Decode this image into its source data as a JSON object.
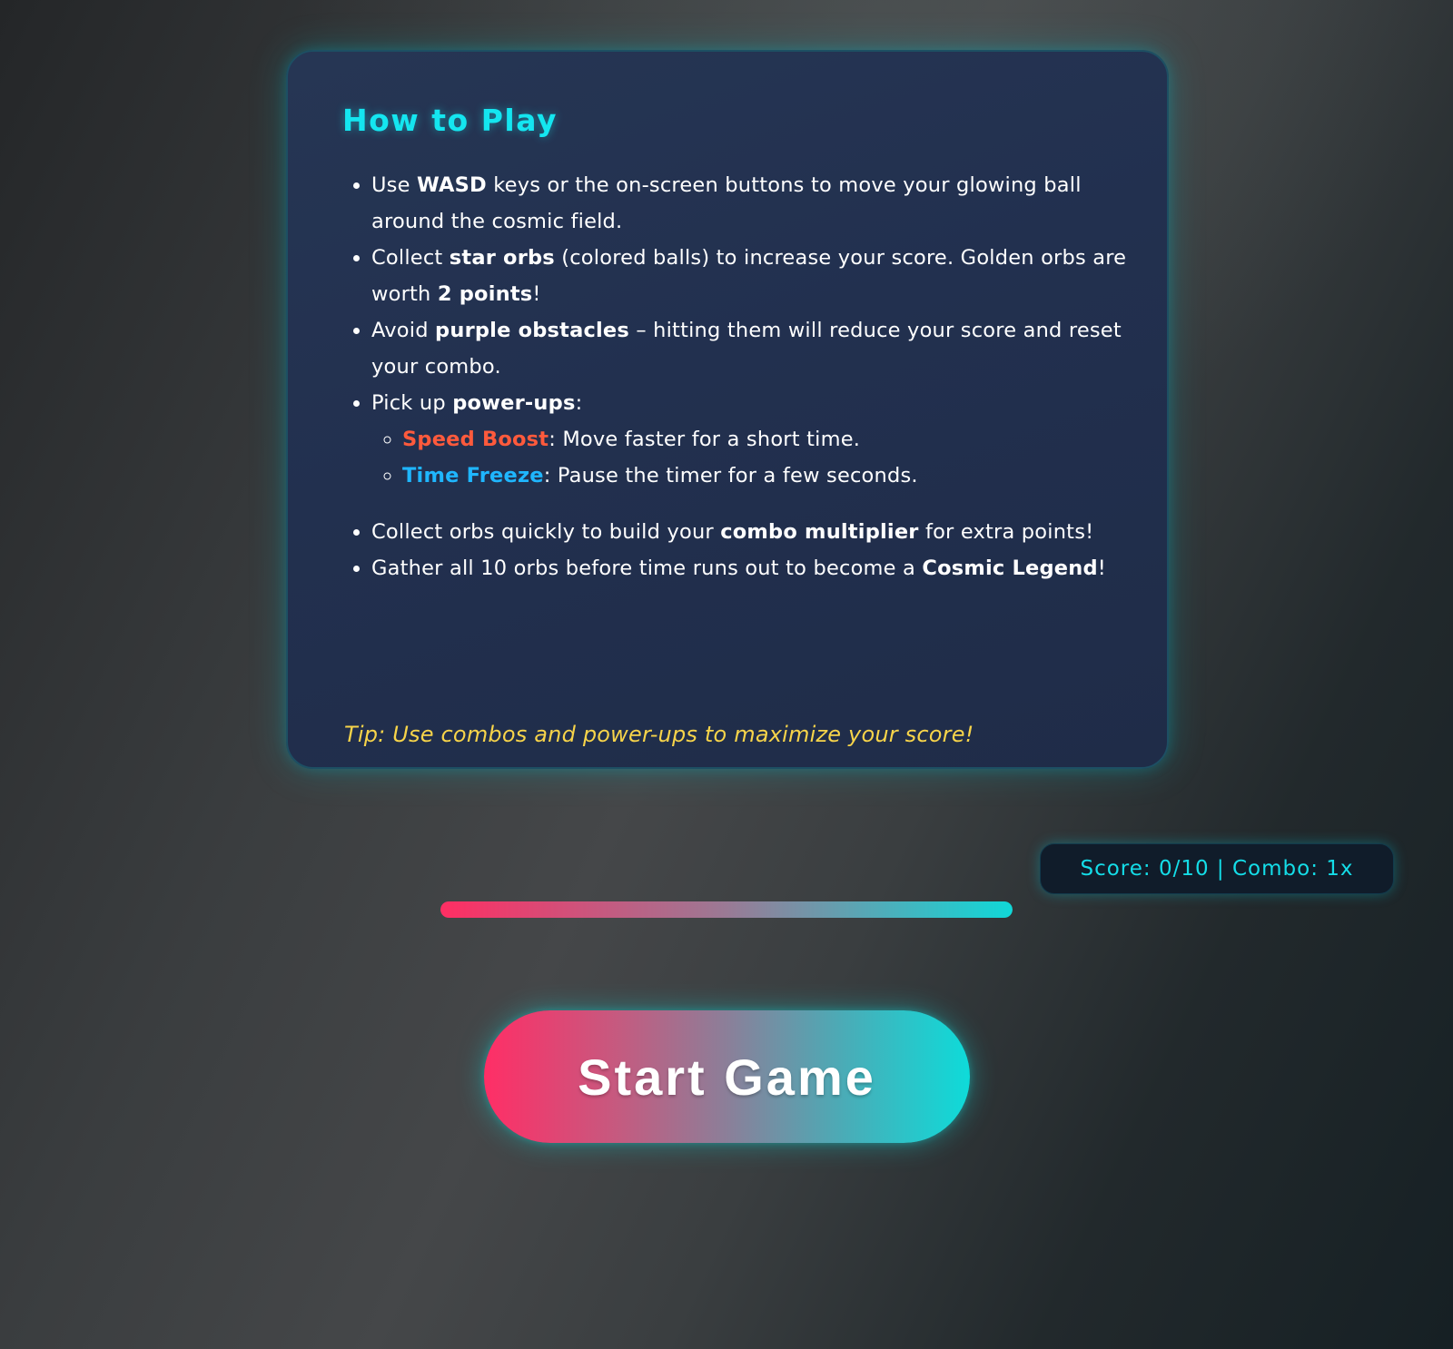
{
  "instructions": {
    "title": "How to Play",
    "rules": [
      {
        "parts": [
          {
            "text": "Use ",
            "strong": false
          },
          {
            "text": "WASD",
            "strong": true
          },
          {
            "text": " keys or the on-screen buttons to move your glowing ball around the cosmic field.",
            "strong": false
          }
        ]
      },
      {
        "parts": [
          {
            "text": "Collect ",
            "strong": false
          },
          {
            "text": "star orbs",
            "strong": true
          },
          {
            "text": " (colored balls) to increase your score. Golden orbs are worth ",
            "strong": false
          },
          {
            "text": "2 points",
            "strong": true
          },
          {
            "text": "!",
            "strong": false
          }
        ]
      },
      {
        "parts": [
          {
            "text": "Avoid ",
            "strong": false
          },
          {
            "text": "purple obstacles",
            "strong": true
          },
          {
            "text": " – hitting them will reduce your score and reset your combo.",
            "strong": false
          }
        ]
      },
      {
        "parts": [
          {
            "text": "Pick up ",
            "strong": false
          },
          {
            "text": "power-ups",
            "strong": true
          },
          {
            "text": ":",
            "strong": false
          }
        ],
        "sub_items": [
          {
            "name": "Speed Boost",
            "desc": ": Move faster for a short time.",
            "color": "#ff5a3c"
          },
          {
            "name": "Time Freeze",
            "desc": ": Pause the timer for a few seconds.",
            "color": "#1fb6ff"
          }
        ]
      },
      {
        "parts": [
          {
            "text": "Collect orbs quickly to build your ",
            "strong": false
          },
          {
            "text": "combo multiplier",
            "strong": true
          },
          {
            "text": " for extra points!",
            "strong": false
          }
        ]
      },
      {
        "parts": [
          {
            "text": "Gather all 10 orbs before time runs out to become a ",
            "strong": false
          },
          {
            "text": "Cosmic Legend",
            "strong": true
          },
          {
            "text": "!",
            "strong": false
          }
        ]
      }
    ],
    "tip": "Tip: Use combos and power-ups to maximize your score!"
  },
  "hud": {
    "score_text": "Score: 0/10 | Combo: 1x",
    "timer_remaining": 1.0,
    "timer_colors": [
      "#ff2e63",
      "#10d8d8"
    ]
  },
  "start_button": {
    "label": "Start Game"
  },
  "colors": {
    "accent_cyan": "#14e6f0",
    "tip_yellow": "#f7d44a",
    "speed_boost": "#ff5a3c",
    "time_freeze": "#1fb6ff"
  }
}
